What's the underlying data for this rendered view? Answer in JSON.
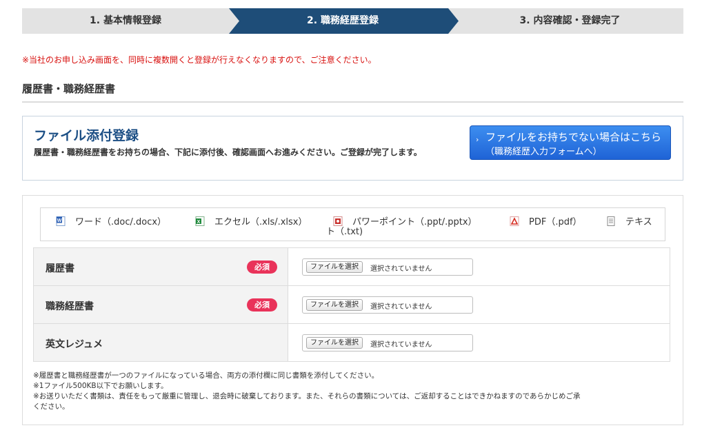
{
  "steps": [
    {
      "label": "1. 基本情報登録",
      "active": false
    },
    {
      "label": "2. 職務経歴登録",
      "active": true
    },
    {
      "label": "3. 内容確認・登録完了",
      "active": false
    }
  ],
  "notice": "※当社のお申し込み画面を、同時に複数開くと登録が行えなくなりますので、ご注意ください。",
  "section_title": "履歴書・職務経歴書",
  "upload_box": {
    "heading": "ファイル添付登録",
    "description": "履歴書・職務経歴書をお持ちの場合、下記に添付後、確認画面へお進みください。ご登録が完了します。",
    "form_link_line1": "ファイルをお持ちでない場合はこちら",
    "form_link_line2": "（職務経歴入力フォームへ）"
  },
  "formats": [
    {
      "icon": "word-icon",
      "label": "ワード（.doc/.docx）"
    },
    {
      "icon": "excel-icon",
      "label": "エクセル（.xls/.xlsx）"
    },
    {
      "icon": "powerpoint-icon",
      "label": "パワーポイント（.ppt/.pptx）"
    },
    {
      "icon": "pdf-icon",
      "label": "PDF（.pdf）"
    },
    {
      "icon": "text-icon",
      "label": "テキス"
    }
  ],
  "formats_tail": "ト（.txt)",
  "file_rows": [
    {
      "label": "履歴書",
      "required": "必須",
      "button": "ファイルを選択",
      "status": "選択されていません"
    },
    {
      "label": "職務経歴書",
      "required": "必須",
      "button": "ファイルを選択",
      "status": "選択されていません"
    },
    {
      "label": "英文レジュメ",
      "required": "",
      "button": "ファイルを選択",
      "status": "選択されていません"
    }
  ],
  "notes": [
    "※履歴書と職務経歴書が一つのファイルになっている場合、両方の添付欄に同じ書類を添付してください。",
    "※1ファイル500KB以下でお願いします。",
    "※お送りいただく書類は、責任をもって厳重に管理し、退会時に破棄しております。また、それらの書類については、ご返却することはできかねますのであらかじめご承",
    "ください。"
  ],
  "colors": {
    "active_step": "#1e4d78",
    "notice_red": "#d8100e",
    "heading_blue": "#1c4f85",
    "required_badge": "#e9335a",
    "link_button": "#2a73e0"
  }
}
